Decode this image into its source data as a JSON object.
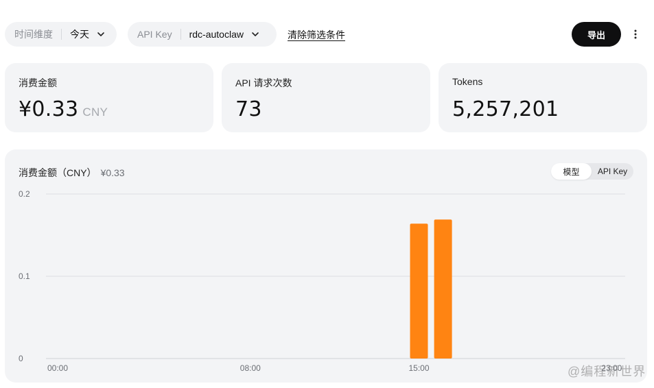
{
  "toolbar": {
    "time_filter": {
      "label": "时间维度",
      "value": "今天"
    },
    "key_filter": {
      "label": "API Key",
      "value": "rdc-autoclaw"
    },
    "clear_label": "清除筛选条件",
    "export_label": "导出"
  },
  "cards": {
    "cost": {
      "title": "消费金额",
      "value": "¥0.33",
      "unit": "CNY"
    },
    "requests": {
      "title": "API 请求次数",
      "value": "73"
    },
    "tokens": {
      "title": "Tokens",
      "value": "5,257,201"
    }
  },
  "chart_panel": {
    "title": "消费金额（CNY）",
    "total": "¥0.33",
    "toggle": {
      "options": [
        "模型",
        "API Key"
      ],
      "selected": "模型"
    }
  },
  "chart_data": {
    "type": "bar",
    "bar_color": "#ff8412",
    "ylim": [
      0,
      0.2
    ],
    "yticks": [
      {
        "value": 0.2,
        "label": "0.2"
      },
      {
        "value": 0.1,
        "label": "0.1"
      },
      {
        "value": 0,
        "label": "0"
      }
    ],
    "xlim": [
      0,
      24
    ],
    "xticks": [
      {
        "hour": 0,
        "label": "00:00"
      },
      {
        "hour": 8,
        "label": "08:00"
      },
      {
        "hour": 15,
        "label": "15:00"
      },
      {
        "hour": 23,
        "label": "23:00"
      }
    ],
    "bars": [
      {
        "hour": 15,
        "value": 0.164
      },
      {
        "hour": 16,
        "value": 0.169
      }
    ]
  },
  "watermark": "@编程新世界"
}
